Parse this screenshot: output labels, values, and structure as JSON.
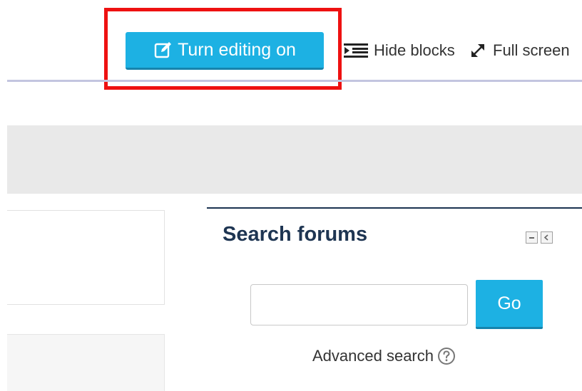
{
  "toolbar": {
    "edit_button_label": "Turn editing on",
    "edit_icon": "edit-icon",
    "hide_blocks_label": "Hide blocks",
    "hide_blocks_icon": "indent-icon",
    "full_screen_label": "Full screen",
    "full_screen_icon": "expand-icon"
  },
  "search_block": {
    "title": "Search forums",
    "input_value": "",
    "go_label": "Go",
    "advanced_label": "Advanced search",
    "help_icon": "help-icon",
    "controls": [
      "collapse-icon",
      "dock-icon"
    ]
  },
  "colors": {
    "button_blue": "#1db1e3",
    "highlight_red": "#ee1111",
    "title_navy": "#1e3552",
    "grey_band": "#e9e9e9",
    "header_rule": "#c3c5e0"
  }
}
